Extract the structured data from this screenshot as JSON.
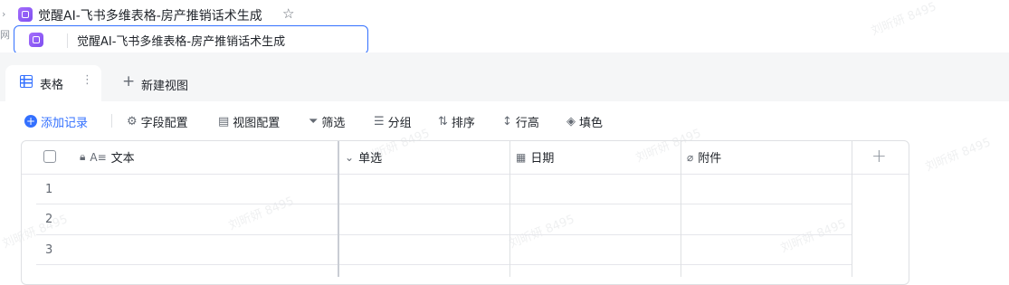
{
  "header": {
    "title": "觉醒AI-飞书多维表格-房产推销话术生成",
    "breadcrumb_chevron": "›",
    "star_icon": "star-outline-icon",
    "side_clip_text": "网"
  },
  "rename": {
    "value": "觉醒AI-飞书多维表格-房产推销话术生成"
  },
  "tabs": {
    "active_label": "表格",
    "more_glyph": "⋮",
    "new_view_label": "新建视图"
  },
  "toolbar": {
    "add_record": "添加记录",
    "field_config": "字段配置",
    "view_config": "视图配置",
    "filter": "筛选",
    "group": "分组",
    "sort": "排序",
    "row_height": "行高",
    "fill_color": "填色"
  },
  "table": {
    "columns": [
      {
        "label": "文本",
        "icon": "text-field-icon"
      },
      {
        "label": "单选",
        "icon": "single-select-icon"
      },
      {
        "label": "日期",
        "icon": "date-icon"
      },
      {
        "label": "附件",
        "icon": "attachment-icon"
      }
    ],
    "rows": [
      "1",
      "2",
      "3"
    ]
  },
  "watermark": "刘昕妍 8495",
  "colors": {
    "accent": "#3370ff",
    "app_icon": "#8a5cf5",
    "tab_strip_bg": "#f5f6f7",
    "border": "#dee0e3"
  }
}
